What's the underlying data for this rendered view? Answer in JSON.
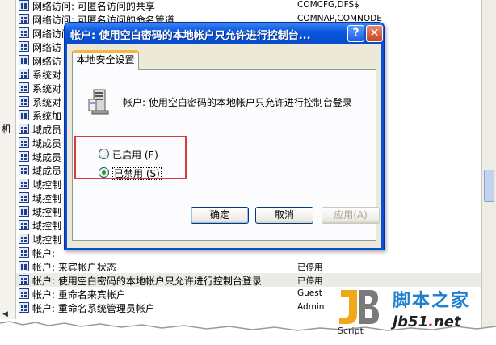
{
  "background": {
    "left_label": "机",
    "rows": [
      {
        "name": "网络访问: 可匿名访问的共享",
        "value": "COMCFG,DFS$"
      },
      {
        "name": "网络访问: 可匿名访问的命名管道",
        "value": "COMNAP,COMNODE"
      },
      {
        "name": "网络访问",
        "value": ""
      },
      {
        "name": "网络访",
        "value": ""
      },
      {
        "name": "网络访",
        "value": ""
      },
      {
        "name": "系统对",
        "value": ""
      },
      {
        "name": "系统对",
        "value": ""
      },
      {
        "name": "系统对",
        "value": ""
      },
      {
        "name": "系统加",
        "value": ""
      },
      {
        "name": "域成员",
        "value": ""
      },
      {
        "name": "域成员",
        "value": ""
      },
      {
        "name": "域成员",
        "value": ""
      },
      {
        "name": "域成员",
        "value": ""
      },
      {
        "name": "域控制",
        "value": ""
      },
      {
        "name": "域控制",
        "value": ""
      },
      {
        "name": "域控制",
        "value": ""
      },
      {
        "name": "域控制",
        "value": ""
      },
      {
        "name": "域控制",
        "value": ""
      },
      {
        "name": "帐户:",
        "value": ""
      },
      {
        "name": "帐户: 来宾帐户状态",
        "value": "已停用"
      },
      {
        "name": "帐户: 使用空白密码的本地帐户只允许进行控制台登录",
        "value": "已停用",
        "selected": true
      },
      {
        "name": "帐户: 重命名来宾帐户",
        "value": "Guest"
      },
      {
        "name": "帐户: 重命名系统管理员帐户",
        "value": "Admin"
      }
    ]
  },
  "dialog": {
    "title": "帐户: 使用空白密码的本地帐户只允许进行控制台...",
    "help_glyph": "?",
    "close_glyph": "✕",
    "tab_label": "本地安全设置",
    "policy_title": "帐户: 使用空白密码的本地帐户只允许进行控制台登录",
    "options": [
      {
        "label": "已启用",
        "hotkey": "(E)",
        "checked": false
      },
      {
        "label": "已禁用",
        "hotkey": "(S)",
        "checked": true
      }
    ],
    "ok_label": "确定",
    "cancel_label": "取消",
    "apply_label": "应用(A)"
  },
  "watermark": {
    "script_text": "Script",
    "cn_text": "脚本之家",
    "url_pre": "jb51",
    "url_dot": ".",
    "url_post": "net"
  },
  "colors": {
    "title_bar": "#0752d6",
    "highlight_box": "#d63a44",
    "watermark_blue": "#1f7fcf"
  },
  "icons": {
    "policy": "policy-icon",
    "server": "server-icon"
  }
}
